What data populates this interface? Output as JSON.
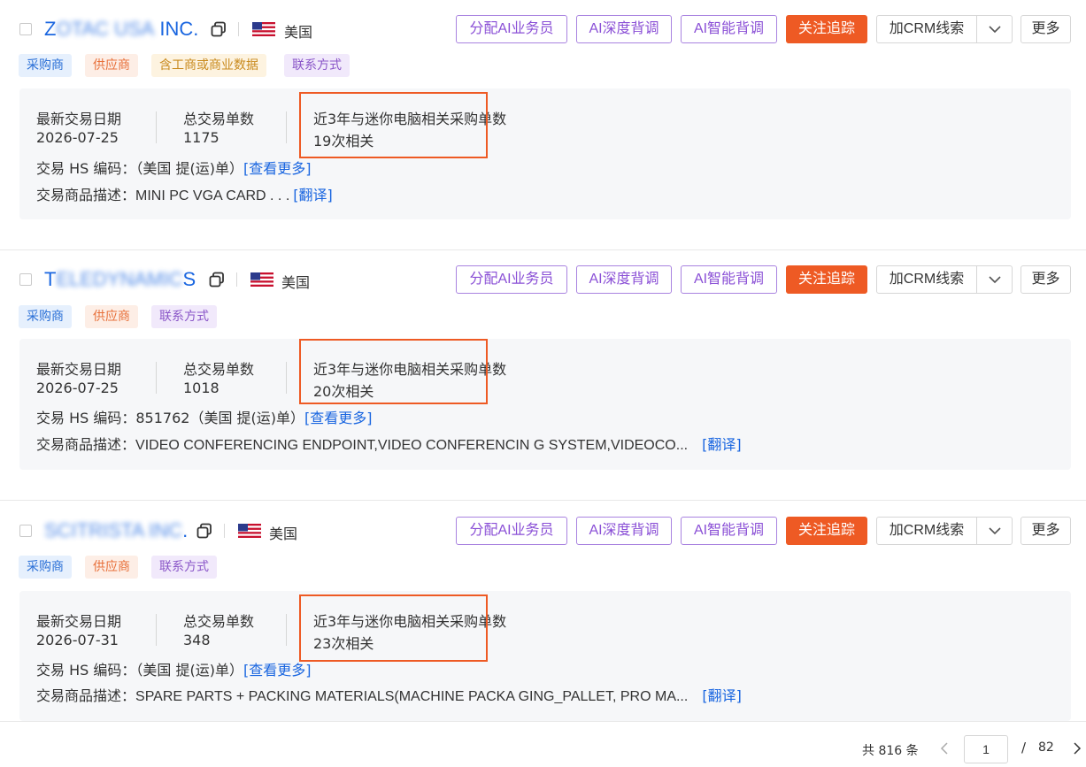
{
  "buttons": {
    "assign_ai": "分配AI业务员",
    "ai_deep": "AI深度背调",
    "ai_smart": "AI智能背调",
    "follow": "关注追踪",
    "crm": "加CRM线索",
    "more": "更多"
  },
  "labels": {
    "latest_date": "最新交易日期",
    "total_orders": "总交易单数",
    "related_orders": "近3年与迷你电脑相关采购单数",
    "hs_code": "交易 HS 编码：",
    "description": "交易商品描述：",
    "view_more": "[查看更多]",
    "translate": "[翻译]"
  },
  "tags": {
    "buyer": "采购商",
    "supplier": "供应商",
    "business_data": "含工商或商业数据",
    "contact": "联系方式"
  },
  "companies": [
    {
      "name_visible_start": "Z",
      "name_blurred": "OTAC USA",
      "name_visible_end": "INC.",
      "country": "美国",
      "latest_date": "2026-07-25",
      "total_orders": "1175",
      "related": "19次相关",
      "hs_value": "（美国 提(运)单）",
      "description": "MINI PC VGA CARD . . ."
    },
    {
      "name_visible_start": "T",
      "name_blurred": "ELEDYNAMIC",
      "name_visible_end": "S",
      "country": "美国",
      "latest_date": "2026-07-25",
      "total_orders": "1018",
      "related": "20次相关",
      "hs_value": "851762（美国 提(运)单）",
      "description": "VIDEO CONFERENCING ENDPOINT,VIDEO CONFERENCIN G SYSTEM,VIDEOCO..."
    },
    {
      "name_visible_start": "",
      "name_blurred": "SCITRISTA INC",
      "name_visible_end": ".",
      "country": "美国",
      "latest_date": "2026-07-31",
      "total_orders": "348",
      "related": "23次相关",
      "hs_value": "（美国 提(运)单）",
      "description": "SPARE PARTS + PACKING MATERIALS(MACHINE PACKA GING_PALLET, PRO MA..."
    }
  ],
  "pagination": {
    "total_text": "共 816 条",
    "current_page": "1",
    "separator": "/",
    "total_pages": "82"
  },
  "colors": {
    "accent": "#ee5a24",
    "link": "#1a66e0",
    "ai_purple": "#8a4fd6"
  }
}
